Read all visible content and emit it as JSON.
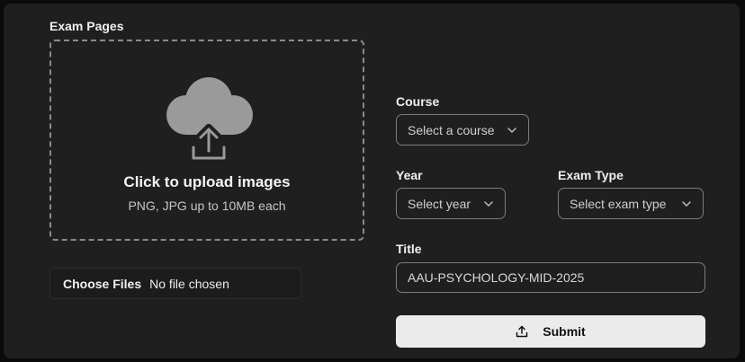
{
  "form": {
    "exam_pages_label": "Exam Pages",
    "dropzone": {
      "title": "Click to upload images",
      "hint": "PNG, JPG up to 10MB each",
      "icon": "cloud-upload-icon"
    },
    "file_input": {
      "button_label": "Choose Files",
      "status": "No file chosen"
    },
    "course": {
      "label": "Course",
      "placeholder": "Select a course"
    },
    "year": {
      "label": "Year",
      "placeholder": "Select year"
    },
    "exam_type": {
      "label": "Exam Type",
      "placeholder": "Select exam type"
    },
    "title": {
      "label": "Title",
      "value": "AAU-PSYCHOLOGY-MID-2025"
    },
    "submit": {
      "label": "Submit",
      "icon": "upload-icon"
    }
  },
  "colors": {
    "background": "#0b0b0b",
    "card": "#1f1f1f",
    "button": "#ebebeb",
    "border": "#7c7c7c"
  }
}
